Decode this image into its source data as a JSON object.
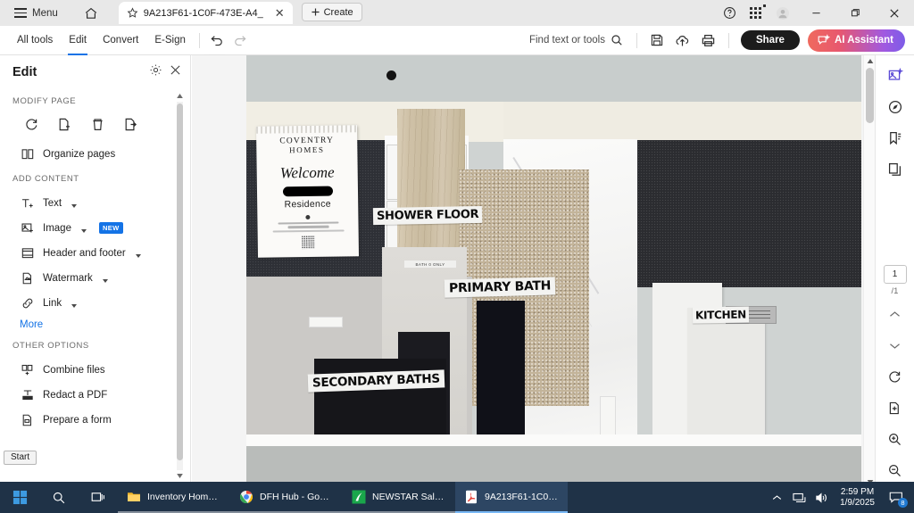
{
  "titlebar": {
    "menu_label": "Menu",
    "home_icon": "home-icon",
    "tab": {
      "title": "9A213F61-1C0F-473E-A4_",
      "star_icon": "star-icon",
      "close_icon": "close-icon"
    },
    "create_label": "Create",
    "help_icon": "help-icon",
    "apps_icon": "apps-grid-icon",
    "account_icon": "account-avatar-icon",
    "minimize_icon": "minimize-icon",
    "restore_icon": "restore-icon",
    "close_icon": "window-close-icon"
  },
  "toolbar": {
    "items": [
      {
        "label": "All tools",
        "active": false
      },
      {
        "label": "Edit",
        "active": true
      },
      {
        "label": "Convert",
        "active": false
      },
      {
        "label": "E-Sign",
        "active": false
      }
    ],
    "undo_icon": "undo-icon",
    "redo_icon": "redo-icon",
    "find_placeholder": "Find text or tools",
    "search_icon": "search-icon",
    "save_icon": "save-icon",
    "upload_icon": "cloud-upload-icon",
    "print_icon": "print-icon",
    "share_label": "Share",
    "ai_label": "AI Assistant",
    "ai_gradient_from": "#ef6a5e",
    "ai_gradient_to": "#7d5ce8",
    "accent": "#1473e6"
  },
  "left_panel": {
    "title": "Edit",
    "settings_icon": "gear-icon",
    "close_icon": "close-icon",
    "sections": [
      {
        "label": "MODIFY PAGE"
      },
      {
        "label": "ADD CONTENT"
      },
      {
        "label": "OTHER OPTIONS"
      }
    ],
    "modify_icons": [
      {
        "name": "rotate-page-icon"
      },
      {
        "name": "insert-page-icon"
      },
      {
        "name": "delete-page-icon"
      },
      {
        "name": "extract-page-icon"
      }
    ],
    "organize_pages": {
      "label": "Organize pages",
      "icon": "organize-pages-icon"
    },
    "add_content": [
      {
        "label": "Text",
        "icon": "add-text-icon",
        "caret": true,
        "badge": ""
      },
      {
        "label": "Image",
        "icon": "add-image-icon",
        "caret": true,
        "badge": "NEW"
      },
      {
        "label": "Header and footer",
        "icon": "header-footer-icon",
        "caret": true,
        "badge": ""
      },
      {
        "label": "Watermark",
        "icon": "watermark-icon",
        "caret": true,
        "badge": ""
      },
      {
        "label": "Link",
        "icon": "link-icon",
        "caret": true,
        "badge": ""
      }
    ],
    "more_label": "More",
    "other_options": [
      {
        "label": "Combine files",
        "icon": "combine-files-icon"
      },
      {
        "label": "Redact a PDF",
        "icon": "redact-icon"
      },
      {
        "label": "Prepare a form",
        "icon": "prepare-form-icon"
      }
    ],
    "start_tooltip": "Start"
  },
  "annotation_toolbar": {
    "tools": [
      {
        "name": "select-cursor-tool",
        "selected": false,
        "caret": true
      },
      {
        "name": "comment-tool",
        "selected": false,
        "caret": true
      },
      {
        "name": "highlighter-tool",
        "selected": true,
        "caret": true
      },
      {
        "name": "freehand-draw-tool",
        "selected": false,
        "caret": true
      },
      {
        "name": "dot-point-tool",
        "selected": false,
        "caret": true
      },
      {
        "name": "eraser-tool",
        "selected": false,
        "caret": true
      },
      {
        "name": "sticky-pin-tool",
        "selected": false,
        "caret": false
      },
      {
        "name": "fill-color-tool",
        "selected": false,
        "caret": false
      },
      {
        "name": "line-thickness-tool",
        "selected": false,
        "caret": false
      },
      {
        "name": "more-tools",
        "selected": false,
        "caret": false
      }
    ]
  },
  "right_rail": {
    "top_icons": [
      {
        "name": "ai-image-icon"
      },
      {
        "name": "discover-icon"
      },
      {
        "name": "bookmark-icon"
      },
      {
        "name": "page-thumbnails-icon"
      }
    ],
    "page_number": "1",
    "page_total": "/1",
    "bottom_icons": [
      {
        "name": "chevron-up-icon"
      },
      {
        "name": "chevron-down-icon"
      },
      {
        "name": "rotate-view-icon"
      },
      {
        "name": "fit-page-icon"
      },
      {
        "name": "zoom-in-icon"
      },
      {
        "name": "zoom-out-icon"
      }
    ]
  },
  "document": {
    "photo_labels": {
      "shower_floor": "SHOWER FLOOR",
      "primary_bath": "PRIMARY BATH",
      "secondary_baths": "SECONDARY BATHS",
      "kitchen": "KITCHEN",
      "bath_only": "BATH 0 ONLY"
    },
    "welcome_sign": {
      "brand_line1": "COVENTRY",
      "brand_line2": "HOMES",
      "welcome": "Welcome",
      "residence": "Residence"
    }
  },
  "taskbar": {
    "start_icon": "windows-start-icon",
    "search_icon": "taskbar-search-icon",
    "taskview_icon": "task-view-icon",
    "items": [
      {
        "label": "Inventory Homes - ...",
        "icon": "file-explorer-icon",
        "active": false
      },
      {
        "label": "DFH Hub - Google ...",
        "icon": "chrome-icon",
        "active": false
      },
      {
        "label": "NEWSTAR Sales Ver...",
        "icon": "newstar-icon",
        "active": false
      },
      {
        "label": "9A213F61-1C0F-47...",
        "icon": "acrobat-icon",
        "active": true
      }
    ],
    "tray": {
      "chevron_icon": "show-hidden-icons",
      "network_icon": "network-icon",
      "volume_icon": "volume-icon",
      "time": "2:59 PM",
      "date": "1/9/2025",
      "notification_icon": "action-center-icon",
      "notification_count": "8"
    }
  }
}
